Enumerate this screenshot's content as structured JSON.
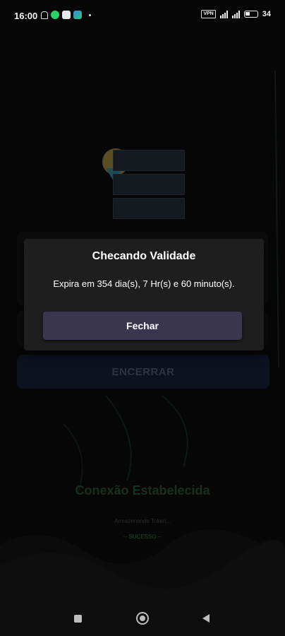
{
  "status_bar": {
    "time": "16:00",
    "vpn_label": "VPN",
    "battery": "34"
  },
  "background": {
    "end_button_label": "ENCERRAR",
    "connection_title": "Conexão Estabelecida",
    "connection_subtitle": "Armazenando Token...",
    "connection_status": "-- SUCESSO --"
  },
  "dialog": {
    "title": "Checando Validade",
    "message": "Expira em 354 dia(s), 7 Hr(s) e 60 minuto(s).",
    "button_label": "Fechar"
  },
  "colors": {
    "dialog_bg": "#1e1e1f",
    "dialog_button": "#3a3650",
    "success_green": "#1d4e2a"
  },
  "icons": {
    "nav": [
      "recent-apps-icon",
      "home-icon",
      "back-icon"
    ],
    "status": [
      "notifications-muted-icon",
      "whatsapp-icon",
      "app-icon",
      "app-icon-2",
      "signal-icon",
      "wifi-icon",
      "battery-icon"
    ]
  }
}
